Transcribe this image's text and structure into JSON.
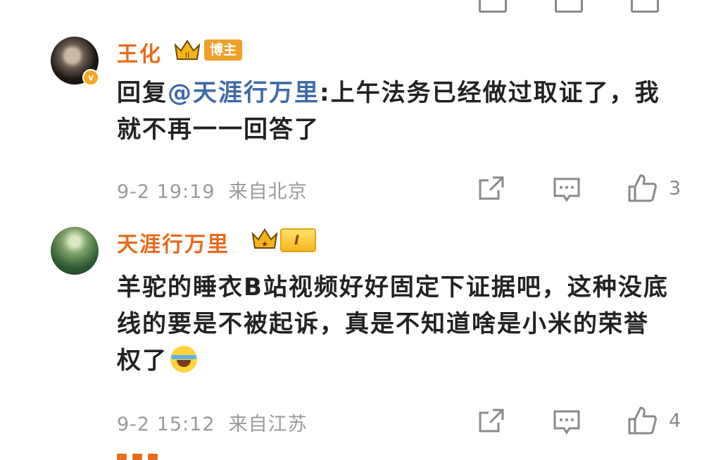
{
  "comments": [
    {
      "username": "王化",
      "badge_level": "II",
      "badge_label": "博主",
      "mention_prefix": "回复",
      "mention": "@天涯行万里",
      "text": ":上午法务已经做过取证了，我就不再一一回答了",
      "time": "9-2 19:19",
      "location": "来自北京",
      "likes": "3"
    },
    {
      "username": "天涯行万里",
      "badge_level": "I",
      "text": "羊驼的睡衣B站视频好好固定下证据吧，这种没底线的要是不被起诉，真是不知道啥是小米的荣誉权了",
      "time": "9-2 15:12",
      "location": "来自江苏",
      "likes": "4"
    }
  ],
  "icons": [
    "share-icon",
    "comment-icon",
    "like-icon",
    "verified-icon",
    "crown-icon",
    "laugh-cry-emoji"
  ],
  "colors": {
    "username": "#e86b1c",
    "mention": "#3e6aa8",
    "meta": "#9a9a9a",
    "blogger_tag": "#f0a02a"
  }
}
